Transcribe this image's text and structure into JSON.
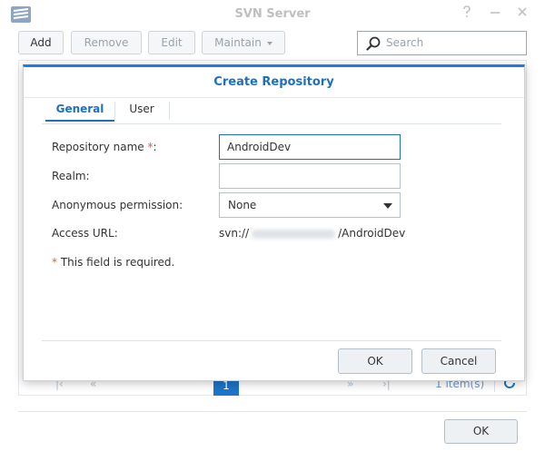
{
  "window": {
    "title": "SVN Server",
    "controls": [
      "help-icon",
      "minimize-icon",
      "close-icon"
    ]
  },
  "toolbar": {
    "add_label": "Add",
    "remove_label": "Remove",
    "edit_label": "Edit",
    "maintain_label": "Maintain",
    "search_placeholder": "Search"
  },
  "pager": {
    "current_page": "1",
    "item_count": "1 item(s)"
  },
  "main_footer": {
    "ok_label": "OK"
  },
  "dialog": {
    "title": "Create Repository",
    "tabs": [
      {
        "label": "General",
        "active": true
      },
      {
        "label": "User",
        "active": false
      }
    ],
    "fields": {
      "repo_name_label": "Repository name",
      "repo_name_value": "AndroidDev",
      "realm_label": "Realm:",
      "realm_value": "",
      "anon_label": "Anonymous permission:",
      "anon_value": "None",
      "url_label": "Access URL:",
      "url_prefix": "svn://",
      "url_suffix": "/AndroidDev"
    },
    "required_note": "This field is required.",
    "ok_label": "OK",
    "cancel_label": "Cancel"
  },
  "colors": {
    "accent": "#1f6fbf",
    "required": "#e05a3a",
    "pager_active": "#1e74c6"
  }
}
